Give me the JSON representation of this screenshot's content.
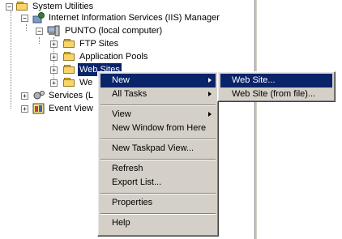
{
  "tree": {
    "root": "System Utilities",
    "iis": "Internet Information Services (IIS) Manager",
    "computer": "PUNTO (local computer)",
    "ftp": "FTP Sites",
    "apppools": "Application Pools",
    "websites_partial": "Web Sites",
    "we_partial": "We",
    "services_partial": "Services (L",
    "eventviewer_partial": "Event View"
  },
  "context_menu": {
    "items": [
      {
        "label": "New",
        "has_submenu": true,
        "highlighted": true
      },
      {
        "label": "All Tasks",
        "has_submenu": true
      },
      {
        "label": "View",
        "has_submenu": true
      },
      {
        "label": "New Window from Here"
      },
      {
        "label": "New Taskpad View..."
      },
      {
        "label": "Refresh"
      },
      {
        "label": "Export List..."
      },
      {
        "label": "Properties"
      },
      {
        "label": "Help"
      }
    ]
  },
  "submenu": {
    "items": [
      {
        "label": "Web Site...",
        "highlighted": true
      },
      {
        "label": "Web Site (from file)..."
      }
    ]
  },
  "colors": {
    "highlight": "#0a246a",
    "menu_bg": "#d4d0c8"
  }
}
